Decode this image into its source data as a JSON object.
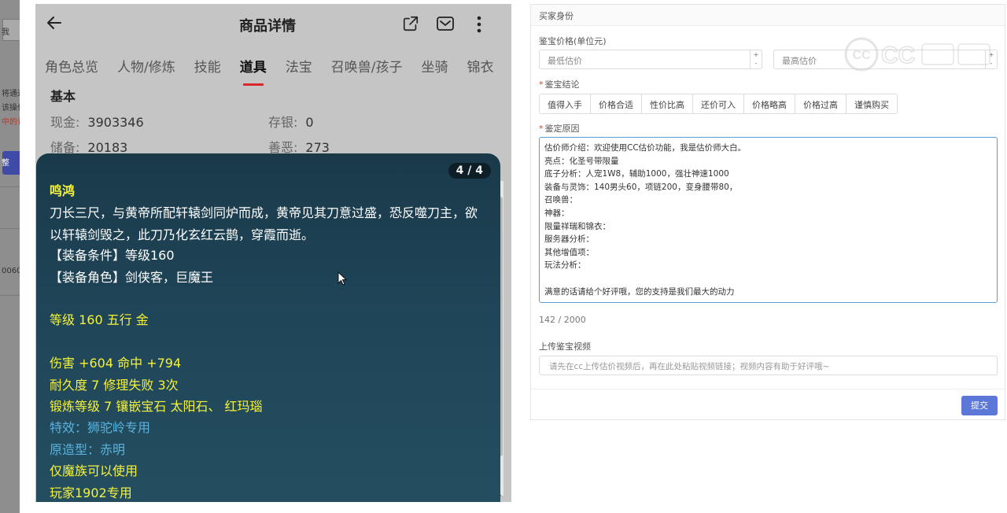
{
  "background_page": {
    "fragments": [
      "我",
      "将通过",
      "该操作",
      "中的订",
      "整",
      "0060"
    ]
  },
  "phone": {
    "title": "商品详情",
    "tabs": [
      {
        "label": "角色总览"
      },
      {
        "label": "人物/修炼"
      },
      {
        "label": "技能"
      },
      {
        "label": "道具"
      },
      {
        "label": "法宝"
      },
      {
        "label": "召唤兽/孩子"
      },
      {
        "label": "坐骑"
      },
      {
        "label": "锦衣"
      }
    ],
    "active_tab": "道具",
    "basic": {
      "title": "基本",
      "stats": [
        {
          "label": "现金:",
          "value": "3903346"
        },
        {
          "label": "存银:",
          "value": "0"
        },
        {
          "label": "储备:",
          "value": "20183"
        },
        {
          "label": "善恶:",
          "value": "273"
        }
      ]
    }
  },
  "item_card": {
    "pager": "4 / 4",
    "name": "鸣鸿",
    "desc_lines": [
      "刀长三尺，与黄帝所配轩辕剑同炉而成，黄帝见其刀意过盛，恐反噬刀主，欲",
      "以轩辕剑毁之，此刀乃化玄红云鹊，穿霞而逝。"
    ],
    "equip_condition": "【装备条件】等级160",
    "equip_role": "【装备角色】剑侠客，巨魔王",
    "level_line": "等级 160 五行 金",
    "damage_line": "伤害 +604 命中 +794",
    "durability_line": "耐久度 7 修理失败 3次",
    "forge_line": "锻炼等级 7 镶嵌宝石 太阳石、 红玛瑙",
    "effect_line": "特效：狮驼岭专用",
    "origin_line": "原造型：赤明",
    "race_line": "仅魔族可以使用",
    "player_line": "玩家1902专用"
  },
  "form": {
    "header": "买家身份",
    "price_label": "鉴宝价格(单位元)",
    "min_placeholder": "最低估价",
    "max_placeholder": "最高估价",
    "conclusion_label": "鉴宝结论",
    "conclusion_options": [
      "值得入手",
      "价格合适",
      "性价比高",
      "还价可入",
      "价格略高",
      "价格过高",
      "谨慎购买"
    ],
    "reason_label": "鉴定原因",
    "reason_lines": [
      "估价师介绍：欢迎使用CC估价功能，我是估价师大白。",
      "亮点：化圣号带限量",
      "底子分析：人宠1W8，辅助1000，强壮神速1000",
      "装备与灵饰：140男头60，项链200，变身腰带80，",
      "召唤兽：",
      "神器：",
      "限量祥瑞和锦衣：",
      "服务器分析：",
      "其他增值项：",
      "玩法分析：",
      "",
      "满意的话请给个好评哦，您的支持是我们最大的动力"
    ],
    "counter": "142 / 2000",
    "video_label": "上传鉴宝视频",
    "video_placeholder": "请先在cc上传估价视频后，再在此处粘贴视频链接；视频内容有助于好评哦~",
    "submit_label": "提交"
  },
  "watermark": {
    "text": "CC估价"
  },
  "colors": {
    "card_yellow": "#f5f23a",
    "card_blue": "#5ab2df",
    "active_tab_underline": "#d8262b",
    "submit": "#5b78d8"
  }
}
